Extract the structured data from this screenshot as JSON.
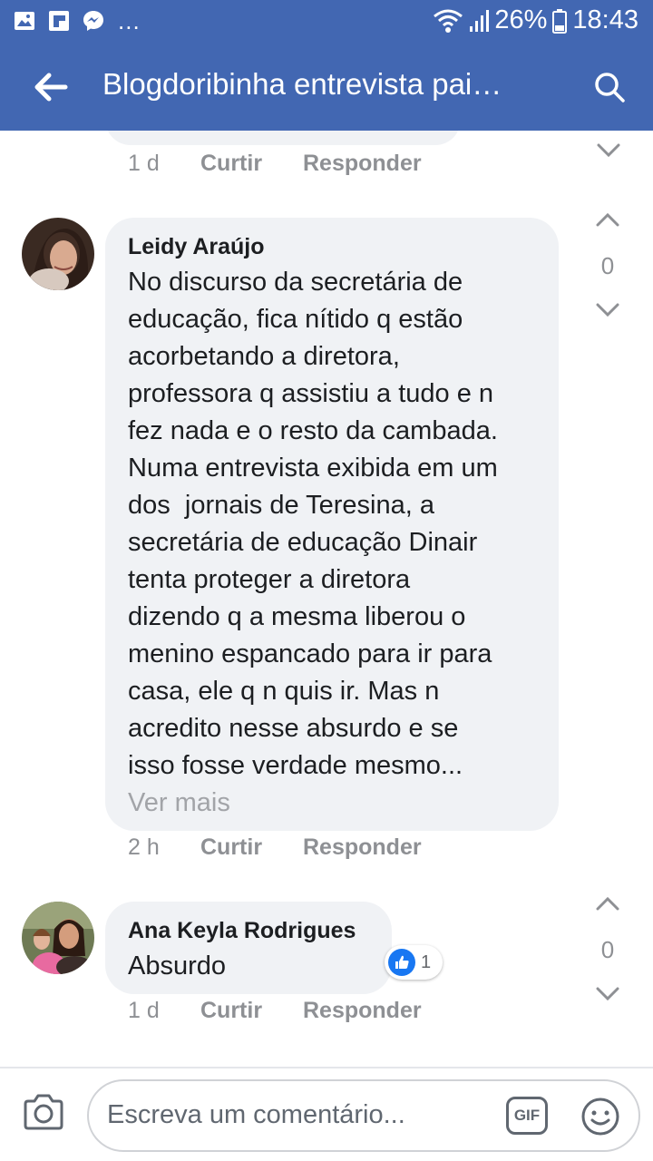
{
  "status_bar": {
    "battery": "26%",
    "time": "18:43",
    "notification_icons": [
      "gallery-icon",
      "flipboard-icon",
      "messenger-icon"
    ],
    "more": "..."
  },
  "header": {
    "title": "Blogdoribinha entrevista pai…",
    "back_icon": "arrow-left-icon",
    "search_icon": "search-icon"
  },
  "comments": [
    {
      "time": "1 d",
      "like_label": "Curtir",
      "reply_label": "Responder"
    },
    {
      "author": "Leidy Araújo",
      "text_lines": [
        "No discurso da secretária de",
        "educação, fica nítido q estão",
        "acorbetando a diretora,",
        "professora q assistiu a tudo e n",
        "fez nada e o resto da cambada.",
        "Numa entrevista exibida em um",
        "dos  jornais de Teresina, a",
        "secretária de educação Dinair",
        "tenta proteger a diretora",
        "dizendo q a mesma liberou o",
        "menino espancado para ir para",
        "casa, ele q n quis ir. Mas n",
        "acredito nesse absurdo e se",
        "isso fosse verdade mesmo..."
      ],
      "see_more": "Ver mais",
      "time": "2 h",
      "like_label": "Curtir",
      "reply_label": "Responder",
      "votes": "0"
    },
    {
      "author": "Ana Keyla Rodrigues",
      "text": "Absurdo",
      "reactions": "1",
      "time": "1 d",
      "like_label": "Curtir",
      "reply_label": "Responder",
      "votes": "0"
    }
  ],
  "composer": {
    "placeholder": "Escreva um comentário...",
    "gif_label": "GIF",
    "camera_icon": "camera-icon",
    "emoji_icon": "smiley-icon"
  },
  "colors": {
    "brand": "#4267b2",
    "bubble": "#f0f2f5",
    "meta_text": "#8e9094",
    "like_blue": "#1877f2"
  }
}
